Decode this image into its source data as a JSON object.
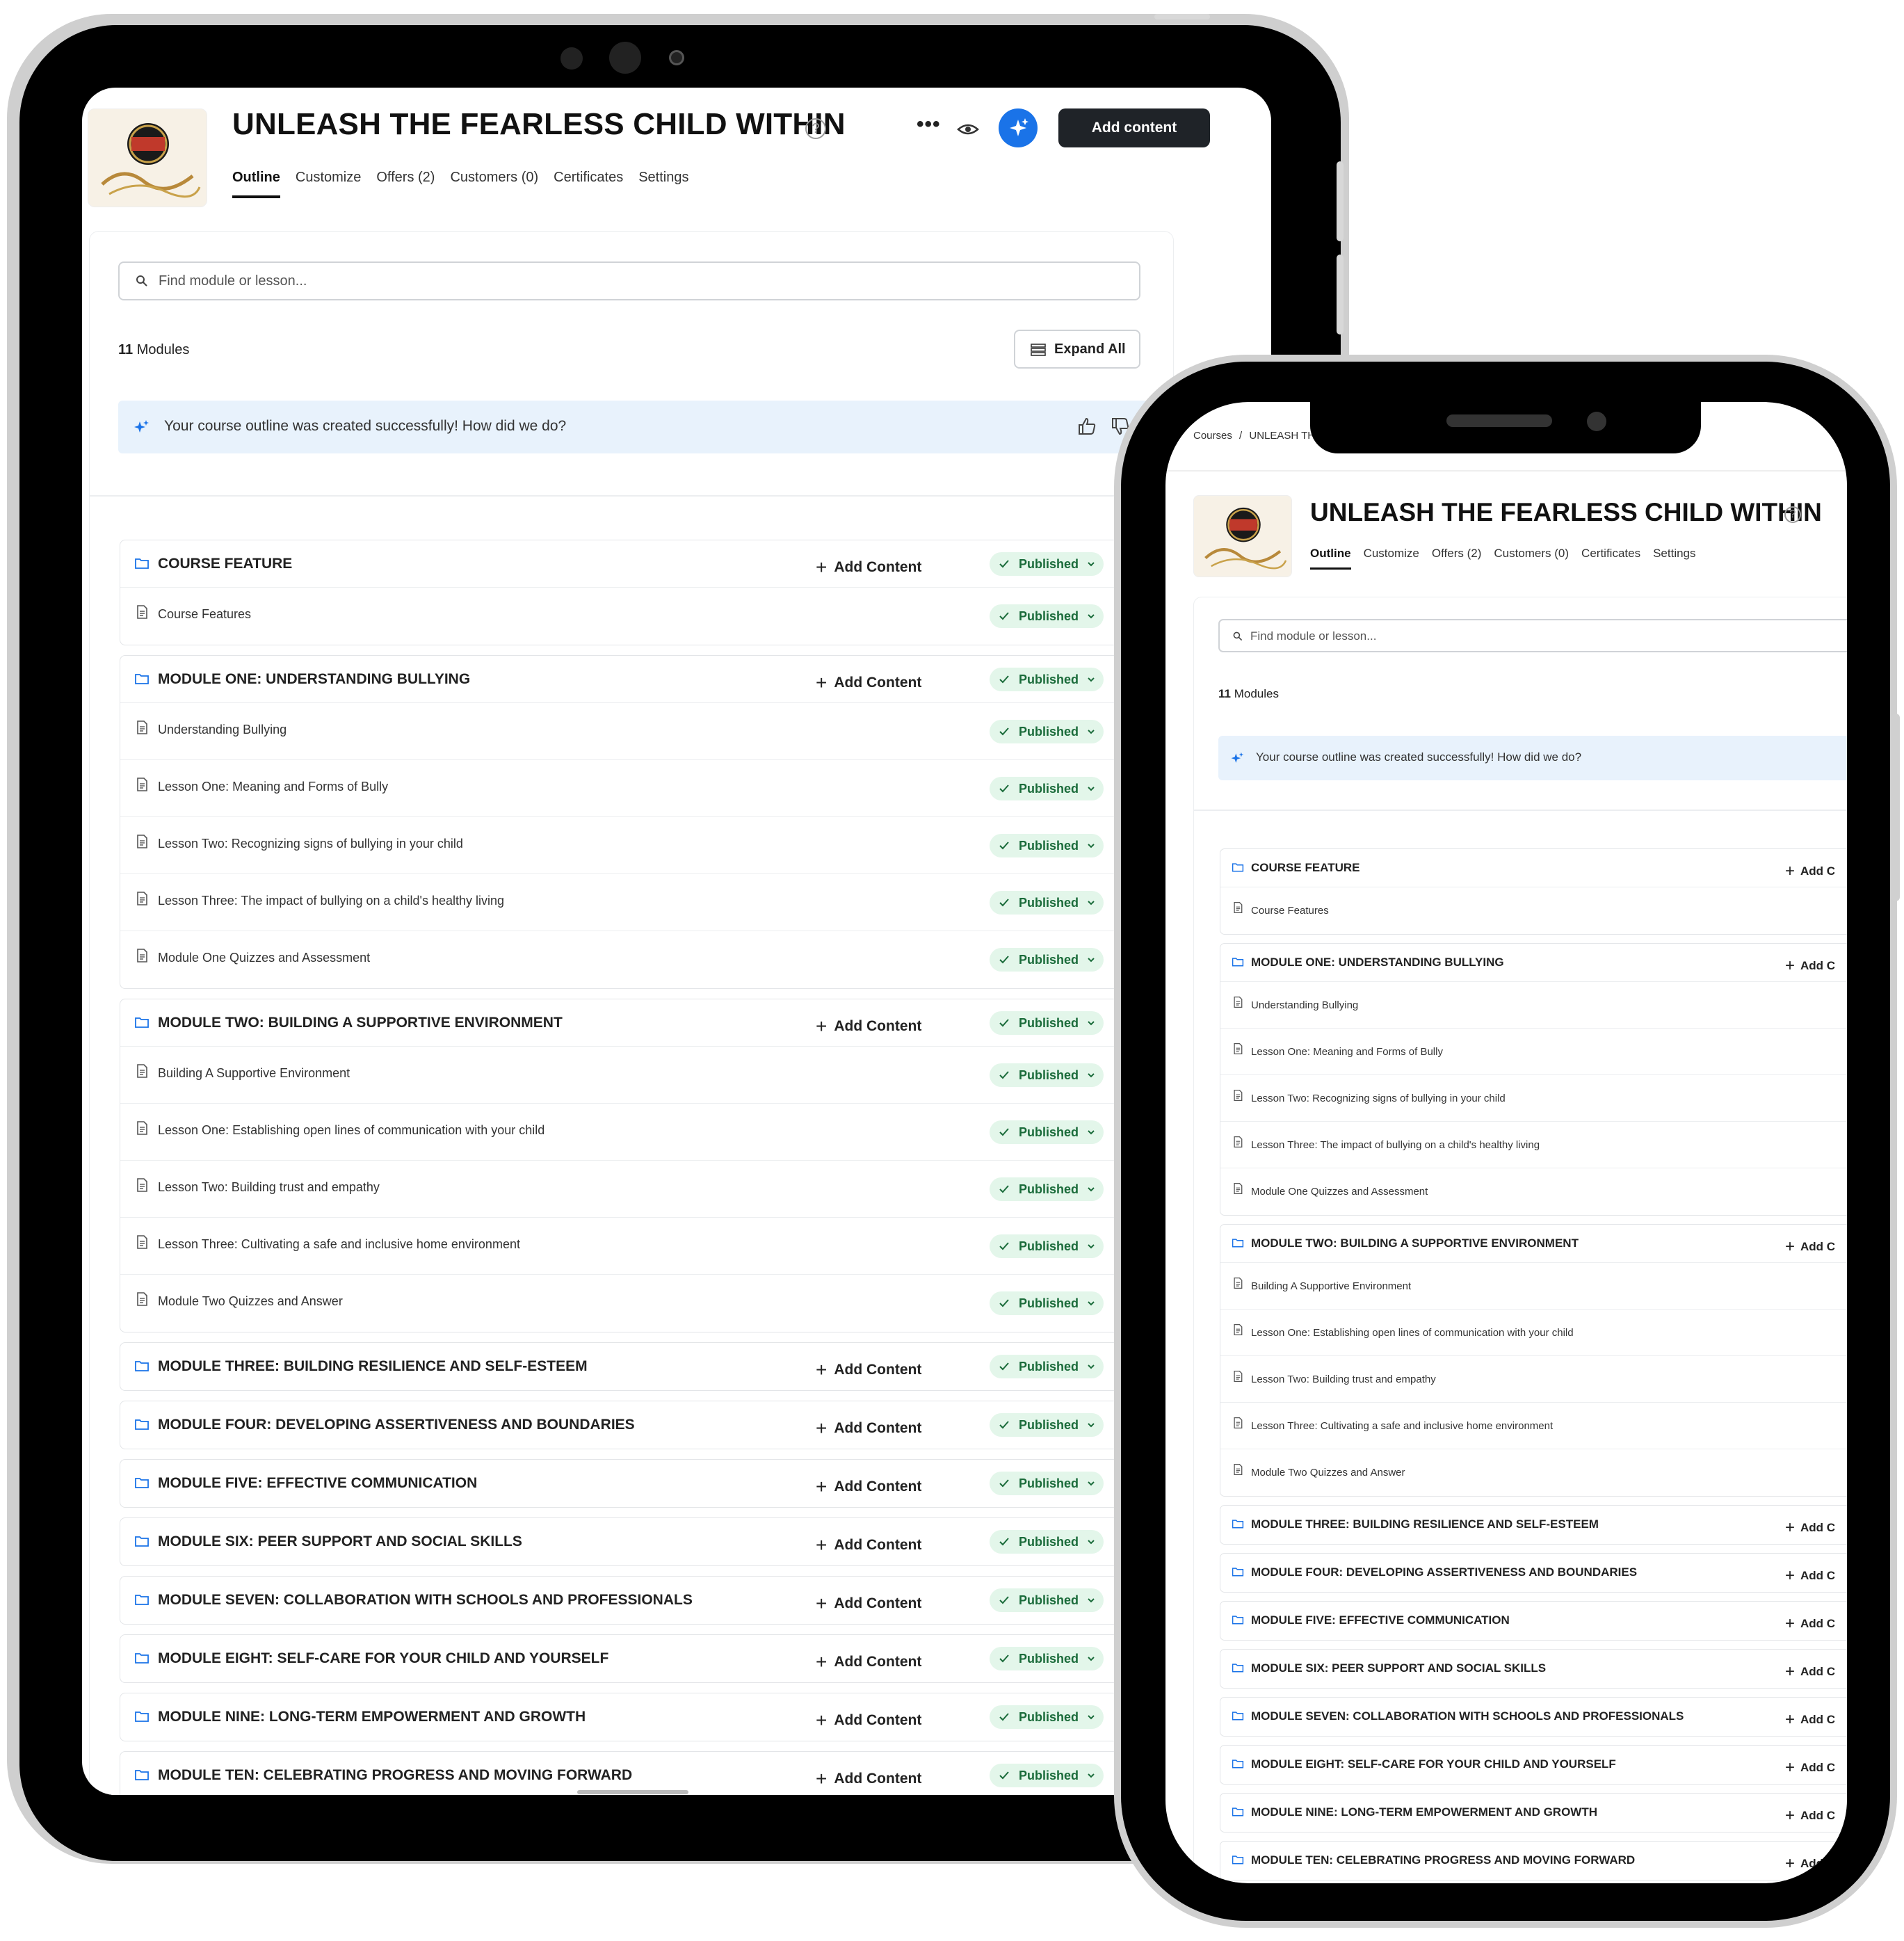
{
  "course": {
    "title": "UNLEASH THE FEARLESS CHILD WITHIN",
    "logo_text": "STOP Bully Proof"
  },
  "header": {
    "add_content_label": "Add content",
    "more_icon": "more-horizontal-icon",
    "preview_icon": "eye-icon",
    "ai_icon": "sparkle-icon"
  },
  "breadcrumb": {
    "root": "Courses",
    "separator": "/",
    "current": "UNLEASH TH"
  },
  "tabs": [
    {
      "label": "Outline"
    },
    {
      "label": "Customize"
    },
    {
      "label": "Offers (2)"
    },
    {
      "label": "Customers (0)"
    },
    {
      "label": "Certificates"
    },
    {
      "label": "Settings"
    }
  ],
  "search": {
    "placeholder": "Find module or lesson..."
  },
  "modules_count": {
    "number": "11",
    "label": "Modules"
  },
  "expand_all_label": "Expand All",
  "banner": {
    "text": "Your course outline was created successfully! How did we do?"
  },
  "status": {
    "published": "Published"
  },
  "row_actions": {
    "add_content": "Add Content",
    "add_content_cut": "Add C"
  },
  "colors": {
    "accent_blue": "#1a73e8",
    "published_bg": "#e3f6ea",
    "published_text": "#1a6b3a",
    "banner_bg": "#e8f2fc",
    "dark_button": "#1f2328"
  },
  "outline": [
    {
      "title": "COURSE FEATURE",
      "lessons": [
        {
          "title": "Course Features"
        }
      ]
    },
    {
      "title": "MODULE ONE: UNDERSTANDING BULLYING",
      "lessons": [
        {
          "title": "Understanding Bullying"
        },
        {
          "title": "Lesson One: Meaning and Forms of Bully"
        },
        {
          "title": "Lesson Two: Recognizing signs of bullying in your child"
        },
        {
          "title": "Lesson Three: The impact of bullying on a child's healthy living"
        },
        {
          "title": "Module One Quizzes and Assessment"
        }
      ]
    },
    {
      "title": "MODULE TWO: BUILDING A SUPPORTIVE ENVIRONMENT",
      "lessons": [
        {
          "title": "Building A Supportive Environment"
        },
        {
          "title": "Lesson One: Establishing open lines of communication with your child"
        },
        {
          "title": "Lesson Two: Building trust and empathy"
        },
        {
          "title": "Lesson Three: Cultivating a safe and inclusive home environment"
        },
        {
          "title": "Module Two Quizzes and Answer"
        }
      ]
    },
    {
      "title": "MODULE THREE: BUILDING RESILIENCE AND SELF-ESTEEM",
      "lessons": []
    },
    {
      "title": "MODULE FOUR: DEVELOPING ASSERTIVENESS AND BOUNDARIES",
      "lessons": []
    },
    {
      "title": "MODULE FIVE: EFFECTIVE COMMUNICATION",
      "lessons": []
    },
    {
      "title": "MODULE SIX: PEER SUPPORT AND SOCIAL SKILLS",
      "lessons": []
    },
    {
      "title": "MODULE SEVEN: COLLABORATION WITH SCHOOLS AND PROFESSIONALS",
      "lessons": []
    },
    {
      "title": "MODULE EIGHT: SELF-CARE FOR YOUR CHILD AND YOURSELF",
      "lessons": []
    },
    {
      "title": "MODULE NINE: LONG-TERM EMPOWERMENT AND GROWTH",
      "lessons": []
    },
    {
      "title": "MODULE TEN: CELEBRATING PROGRESS AND MOVING FORWARD",
      "lessons": []
    }
  ]
}
